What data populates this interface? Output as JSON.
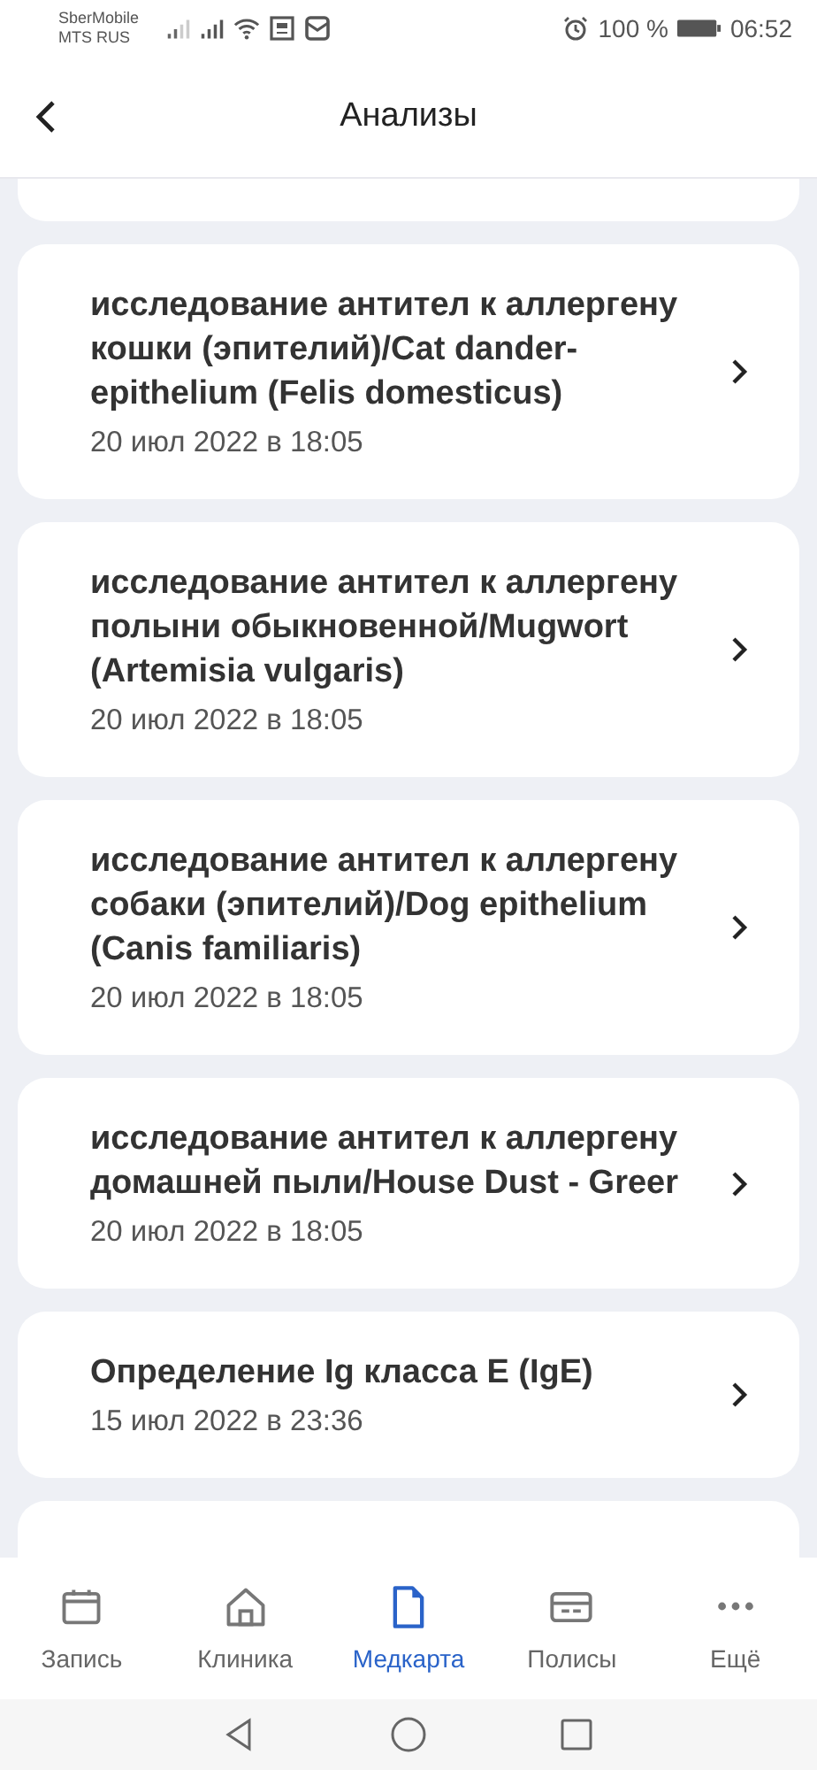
{
  "status_bar": {
    "carrier_1": "SberMobile",
    "carrier_2": "MTS RUS",
    "battery": "100 %",
    "time": "06:52"
  },
  "header": {
    "title": "Анализы"
  },
  "results": [
    {
      "title": "исследование антител к аллергену кошки (эпителий)/Cat dander-epithelium (Felis domesticus)",
      "date": "20 июл 2022 в 18:05"
    },
    {
      "title": "исследование антител к аллергену полыни обыкновенной/Mugwort (Artemisia vulgaris)",
      "date": "20 июл 2022 в 18:05"
    },
    {
      "title": "исследование антител к аллергену собаки (эпителий)/Dog epithelium (Canis familiaris)",
      "date": "20 июл 2022 в 18:05"
    },
    {
      "title": "исследование антител к аллергену домашней пыли/House Dust - Greer",
      "date": "20 июл 2022 в 18:05"
    },
    {
      "title": "Определение Ig класса E (IgE)",
      "date": "15 июл 2022 в 23:36"
    }
  ],
  "tab_bar": [
    {
      "kind": "calendar",
      "label": "Запись",
      "selected": false
    },
    {
      "kind": "house",
      "label": "Клиника",
      "selected": false
    },
    {
      "kind": "document",
      "label": "Медкарта",
      "selected": true
    },
    {
      "kind": "card",
      "label": "Полисы",
      "selected": false
    },
    {
      "kind": "more",
      "label": "Ещё",
      "selected": false
    }
  ]
}
